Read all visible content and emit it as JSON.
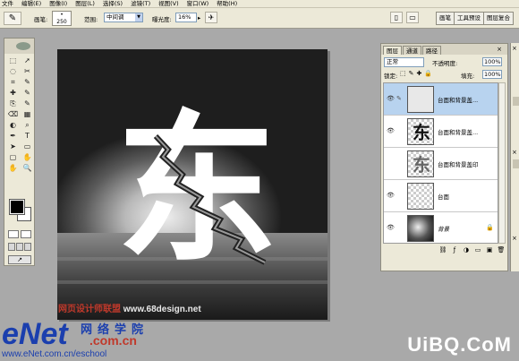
{
  "menu": [
    "文件",
    "编辑(E)",
    "图像(I)",
    "图层(L)",
    "选择(S)",
    "滤镜(T)",
    "视图(V)",
    "窗口(W)",
    "帮助(H)"
  ],
  "options": {
    "tool_glyph": "✎",
    "brush_label": "画笔:",
    "brush_size": "250",
    "range_label": "范围:",
    "range_value": "中间调",
    "exposure_label": "曝光度:",
    "exposure_value": "16%",
    "airbrush_glyph": "✈",
    "palette_tabs": [
      "画笔",
      "工具预设",
      "图层复合"
    ]
  },
  "toolbox": {
    "tools": [
      "⬚",
      "➚",
      "◌",
      "✂",
      "⌗",
      "✎",
      "✚",
      "✎",
      "⎘",
      "✎",
      "⌫",
      "▦",
      "◐",
      "⌕",
      "✒",
      "T",
      "➤",
      "▭",
      "▢",
      "✋",
      "✋",
      "🔍"
    ],
    "jump_glyph": "↗"
  },
  "canvas": {
    "big_char": "东"
  },
  "watermark": {
    "site_cn": "网页设计师联盟",
    "site_url": "www.68design.net",
    "enet": "eNet",
    "enet_cn": "网络学院",
    "enet_com": ".com.cn",
    "enet_url": "www.eNet.com.cn/eschool",
    "uibq": "UiBQ.CoM"
  },
  "layers_panel": {
    "tabs": [
      "图层",
      "通道",
      "路径"
    ],
    "close_glyph": "×",
    "blend_mode": "正常",
    "opacity_label": "不透明度:",
    "opacity_value": "100%",
    "lock_label": "锁定:",
    "lock_icons": "⬚✎✚🔒",
    "fill_label": "填充:",
    "fill_value": "100%",
    "layers": [
      {
        "name": "台面和背景盖...",
        "visible": true,
        "selected": true,
        "linked": true,
        "thumb": "blank"
      },
      {
        "name": "台面和背景盖...",
        "visible": true,
        "selected": false,
        "linked": false,
        "thumb": "char",
        "thumb_char": "东"
      },
      {
        "name": "台面和背景盖印",
        "visible": false,
        "selected": false,
        "linked": false,
        "thumb": "char-faded",
        "thumb_char": "东"
      },
      {
        "name": "台面",
        "visible": true,
        "selected": false,
        "linked": false,
        "thumb": "checker"
      },
      {
        "name": "背景",
        "visible": true,
        "selected": false,
        "linked": false,
        "thumb": "gradient",
        "locked": true
      }
    ],
    "bottom_icons": [
      "⛓",
      "ƒ",
      "◑",
      "▭",
      "▣",
      "🗑"
    ]
  }
}
